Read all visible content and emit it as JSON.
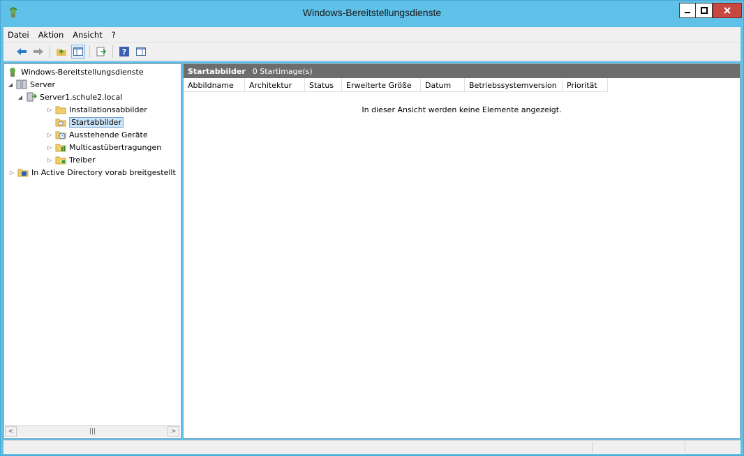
{
  "window": {
    "title": "Windows-Bereitstellungsdienste",
    "controls": [
      "minimize",
      "maximize",
      "close"
    ]
  },
  "menu": {
    "items": [
      "Datei",
      "Aktion",
      "Ansicht",
      "?"
    ]
  },
  "toolbar": {
    "buttons": [
      "back-arrow-icon",
      "forward-arrow-icon",
      "up-folder-icon",
      "show-hide-tree-icon",
      "export-list-icon",
      "help-icon",
      "properties-pane-icon"
    ]
  },
  "tree": {
    "root": "Windows-Bereitstellungsdienste",
    "server_group": "Server",
    "server": "Server1.schule2.local",
    "children": [
      "Installationsabbilder",
      "Startabbilder",
      "Ausstehende Geräte",
      "Multicastübertragungen",
      "Treiber"
    ],
    "selected": "Startabbilder",
    "ad_node": "In Active Directory vorab breitgestellt"
  },
  "content": {
    "header_title": "Startabbilder",
    "header_count": "0 Startimage(s)",
    "columns": [
      "Abbildname",
      "Architektur",
      "Status",
      "Erweiterte Größe",
      "Datum",
      "Betriebssystemversion",
      "Priorität"
    ],
    "empty_message": "In dieser Ansicht werden keine Elemente angezeigt."
  },
  "colors": {
    "titlebar": "#5fc0e8",
    "close_button": "#c74840",
    "content_header": "#6d6d6d",
    "selection": "#cce4f7"
  }
}
